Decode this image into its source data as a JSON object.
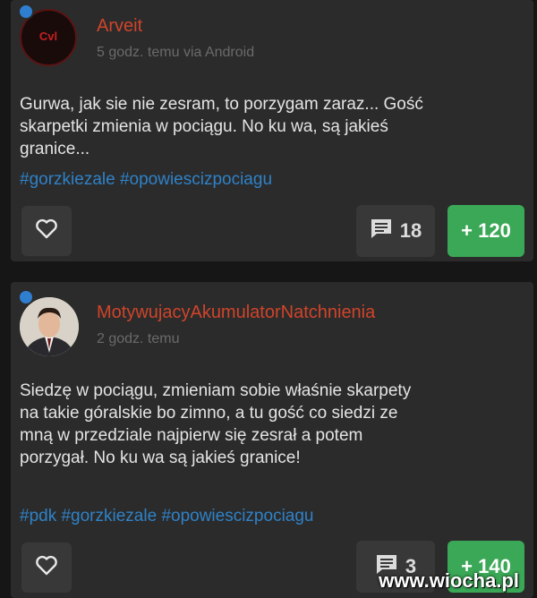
{
  "posts": [
    {
      "avatar_text": "Cvl",
      "username": "Arveit",
      "meta": "5 godz. temu via Android",
      "body": "Gurwa, jak sie nie zesram, to porzygam zaraz... Gość\nskarpetki zmienia w pociągu. No ku  wa, są jakieś\ngranice...",
      "tags": [
        "#gorzkiezale",
        "#opowiescizpociagu"
      ],
      "comment_count": "18",
      "vote_count": "+ 120",
      "icons": {
        "like": "heart-icon",
        "comments": "comment-icon"
      }
    },
    {
      "username": "MotywujacyAkumulatorNatchnienia",
      "meta": "2 godz. temu",
      "body": "Siedzę w pociągu, zmieniam sobie właśnie skarpety\nna takie góralskie bo zimno, a tu gość co siedzi ze\nmną w przedziale najpierw się zesrał a potem\nporzygał. No ku  wa są jakieś granice!",
      "tags": [
        "#pdk",
        "#gorzkiezale",
        "#opowiescizpociagu"
      ],
      "comment_count": "3",
      "vote_count": "+ 140",
      "icons": {
        "like": "heart-icon",
        "comments": "comment-icon"
      }
    }
  ],
  "watermark": "www.wiocha.pl",
  "colors": {
    "background": "#161616",
    "card": "#2b2b2b",
    "username": "#d0442a",
    "tag": "#2f82c8",
    "vote": "#3aa856",
    "online_dot": "#2f7fd0"
  }
}
